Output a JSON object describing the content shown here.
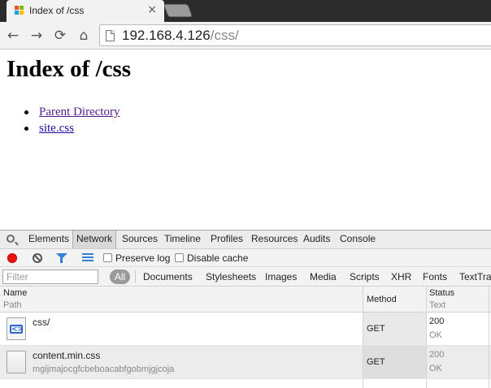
{
  "tab": {
    "title": "Index of /css",
    "close_label": "×"
  },
  "toolbar": {
    "back": "←",
    "forward": "→",
    "reload": "⟳",
    "home": "⌂"
  },
  "address": {
    "host": "192.168.4.126",
    "path": "/css/"
  },
  "page": {
    "heading": "Index of /css",
    "links": [
      {
        "label": "Parent Directory"
      },
      {
        "label": "site.css"
      }
    ]
  },
  "devtools": {
    "tabs": [
      "Elements",
      "Network",
      "Sources",
      "Timeline",
      "Profiles",
      "Resources",
      "Audits",
      "Console"
    ],
    "active_tab": "Network",
    "preserve_log": "Preserve log",
    "disable_cache": "Disable cache",
    "filter_placeholder": "Filter",
    "type_filters": {
      "all": "All",
      "items": [
        "Documents",
        "Stylesheets",
        "Images",
        "Media",
        "Scripts",
        "XHR",
        "Fonts",
        "TextTra"
      ]
    },
    "columns": {
      "name": "Name",
      "path": "Path",
      "method": "Method",
      "status": "Status",
      "text": "Text"
    },
    "requests": [
      {
        "name": "css/",
        "path": "",
        "method": "GET",
        "status": "200",
        "status_text": "OK"
      },
      {
        "name": "content.min.css",
        "path": "mgijmajocgfcbeboacabfgobmjgjcoja",
        "method": "GET",
        "status": "200",
        "status_text": "OK"
      }
    ]
  },
  "colors": {
    "record": "#e11111",
    "filter_accent": "#2f7fd8",
    "visited_link": "#551a8b"
  }
}
